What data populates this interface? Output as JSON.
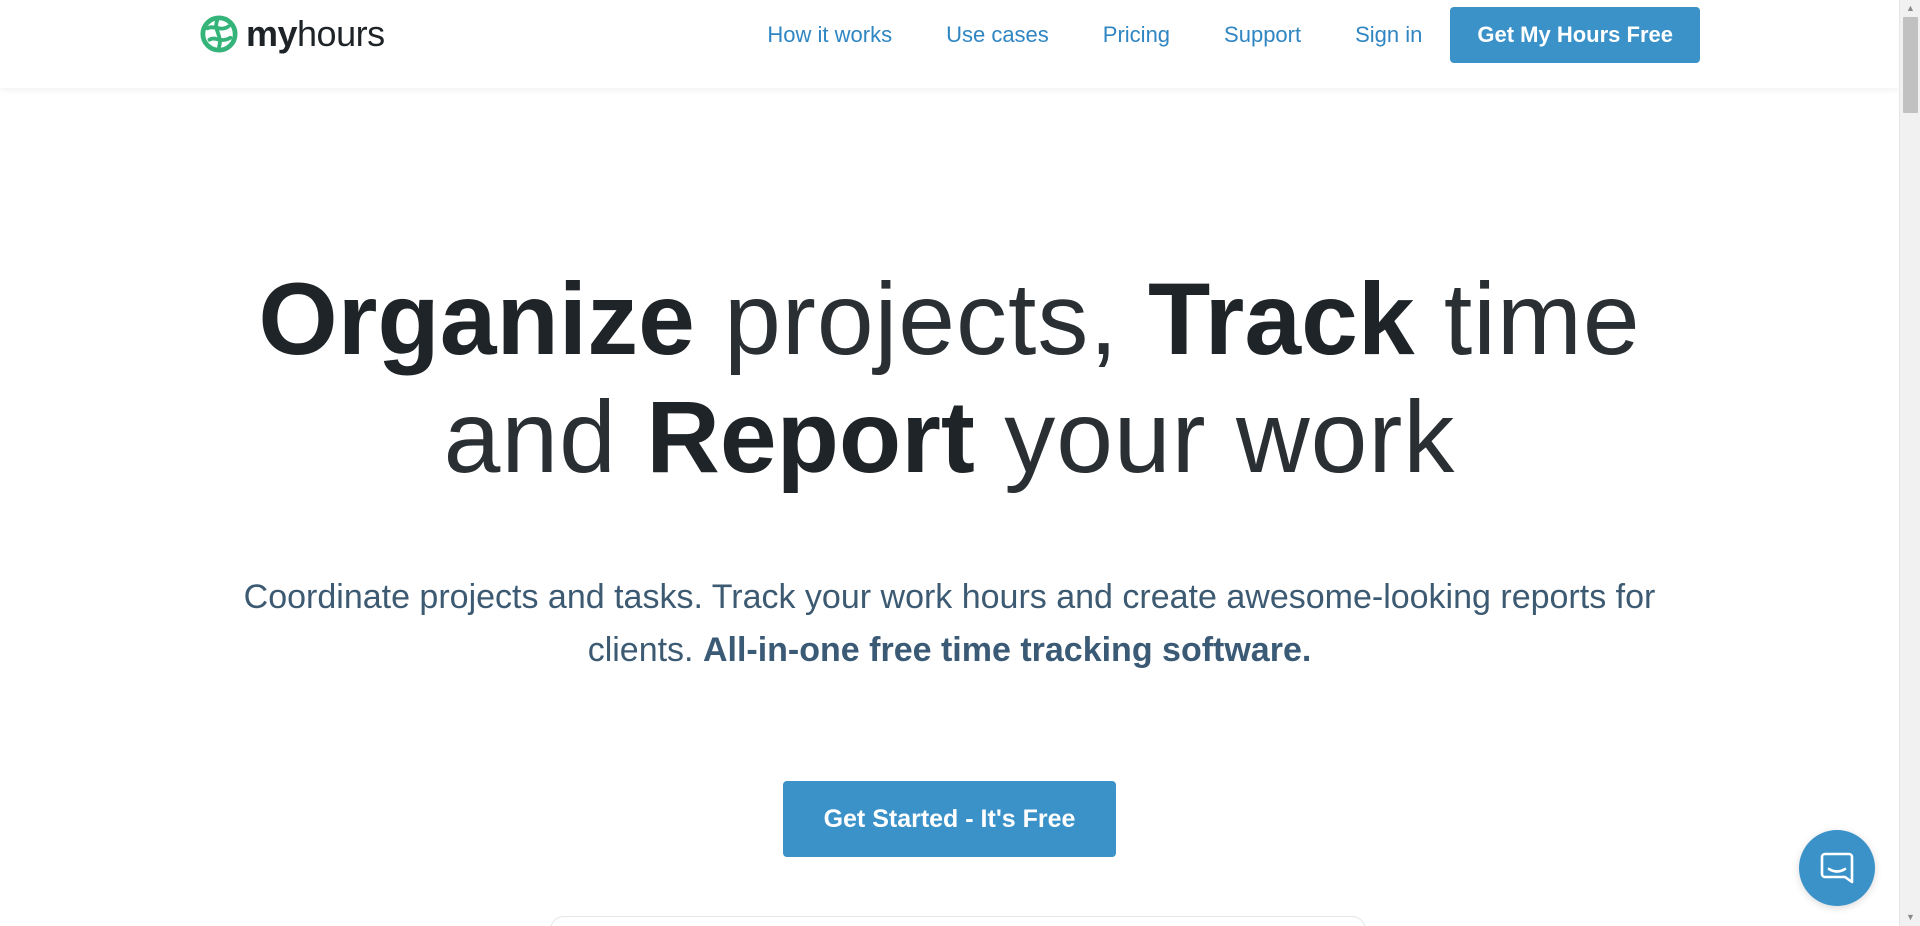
{
  "brand": {
    "logo_bold": "my",
    "logo_light": "hours",
    "accent": "#3a92c9",
    "logo_green": "#35b47a"
  },
  "nav": {
    "links": [
      "How it works",
      "Use cases",
      "Pricing",
      "Support",
      "Sign in"
    ],
    "cta_label": "Get My Hours Free"
  },
  "hero": {
    "headline": {
      "w1": "Organize",
      "w2": " projects, ",
      "w3": "Track",
      "w4": " time",
      "w5": "and ",
      "w6": "Report",
      "w7": " your work"
    },
    "subtext_regular": "Coordinate projects and tasks. Track your work hours and create awesome-looking reports for clients. ",
    "subtext_bold": "All-in-one free time tracking software.",
    "cta_label": "Get Started - It's Free"
  },
  "chat": {
    "icon": "chat-icon"
  }
}
